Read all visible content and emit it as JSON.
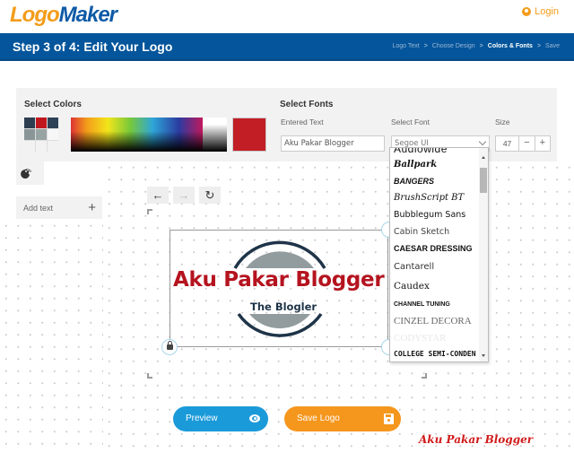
{
  "header": {
    "brand_part1": "Logo",
    "brand_part2": "Maker",
    "login_label": "Login"
  },
  "stepbar": {
    "title": "Step 3 of 4: Edit Your Logo",
    "crumbs": [
      "Logo Text",
      "Choose Design",
      "Colors & Fonts",
      "Save"
    ],
    "active_crumb": "Colors & Fonts",
    "separator": ">"
  },
  "colors_panel": {
    "title": "Select Colors",
    "swatches": [
      "#2d3e50",
      "#c0171f",
      "#2d4256",
      "#8a9598",
      "#98a3a3",
      "#f7f7f7",
      "#f2f2f2",
      "#f2f2f2",
      "#f2f2f2"
    ],
    "selected_color": "#c11e25"
  },
  "fonts_panel": {
    "title": "Select Fonts",
    "entered_text_label": "Entered Text",
    "entered_text_value": "Aku Pakar Blogger",
    "select_font_label": "Select Font",
    "selected_font": "Segoe UI",
    "size_label": "Size",
    "size_value": "47",
    "minus_label": "−",
    "plus_label": "+",
    "font_options": [
      "Audiowide",
      "Ballpark",
      "BANGERS",
      "BrushScript BT",
      "Bubblegum Sans",
      "Cabin Sketch",
      "CAESAR DRESSING",
      "Cantarell",
      "Caudex",
      "CHANNEL TUNING",
      "CINZEL DECORA",
      "CODYSTAR",
      "COLLEGE SEMI-CONDEN"
    ]
  },
  "sidebar": {
    "add_text_label": "Add text",
    "add_text_plus": "+"
  },
  "toolbar": {
    "undo_glyph": "←",
    "redo_glyph": "→",
    "reset_glyph": "↻"
  },
  "logo": {
    "main_text": "Aku Pakar Blogger",
    "sub_text": "The Blogler",
    "main_color": "#b5141f",
    "sub_color": "#1f3448",
    "ring_color": "#1f3448",
    "fill_color": "#929c9e"
  },
  "actions": {
    "preview_label": "Preview",
    "save_label": "Save Logo"
  },
  "watermark": "Aku Pakar Blogger"
}
